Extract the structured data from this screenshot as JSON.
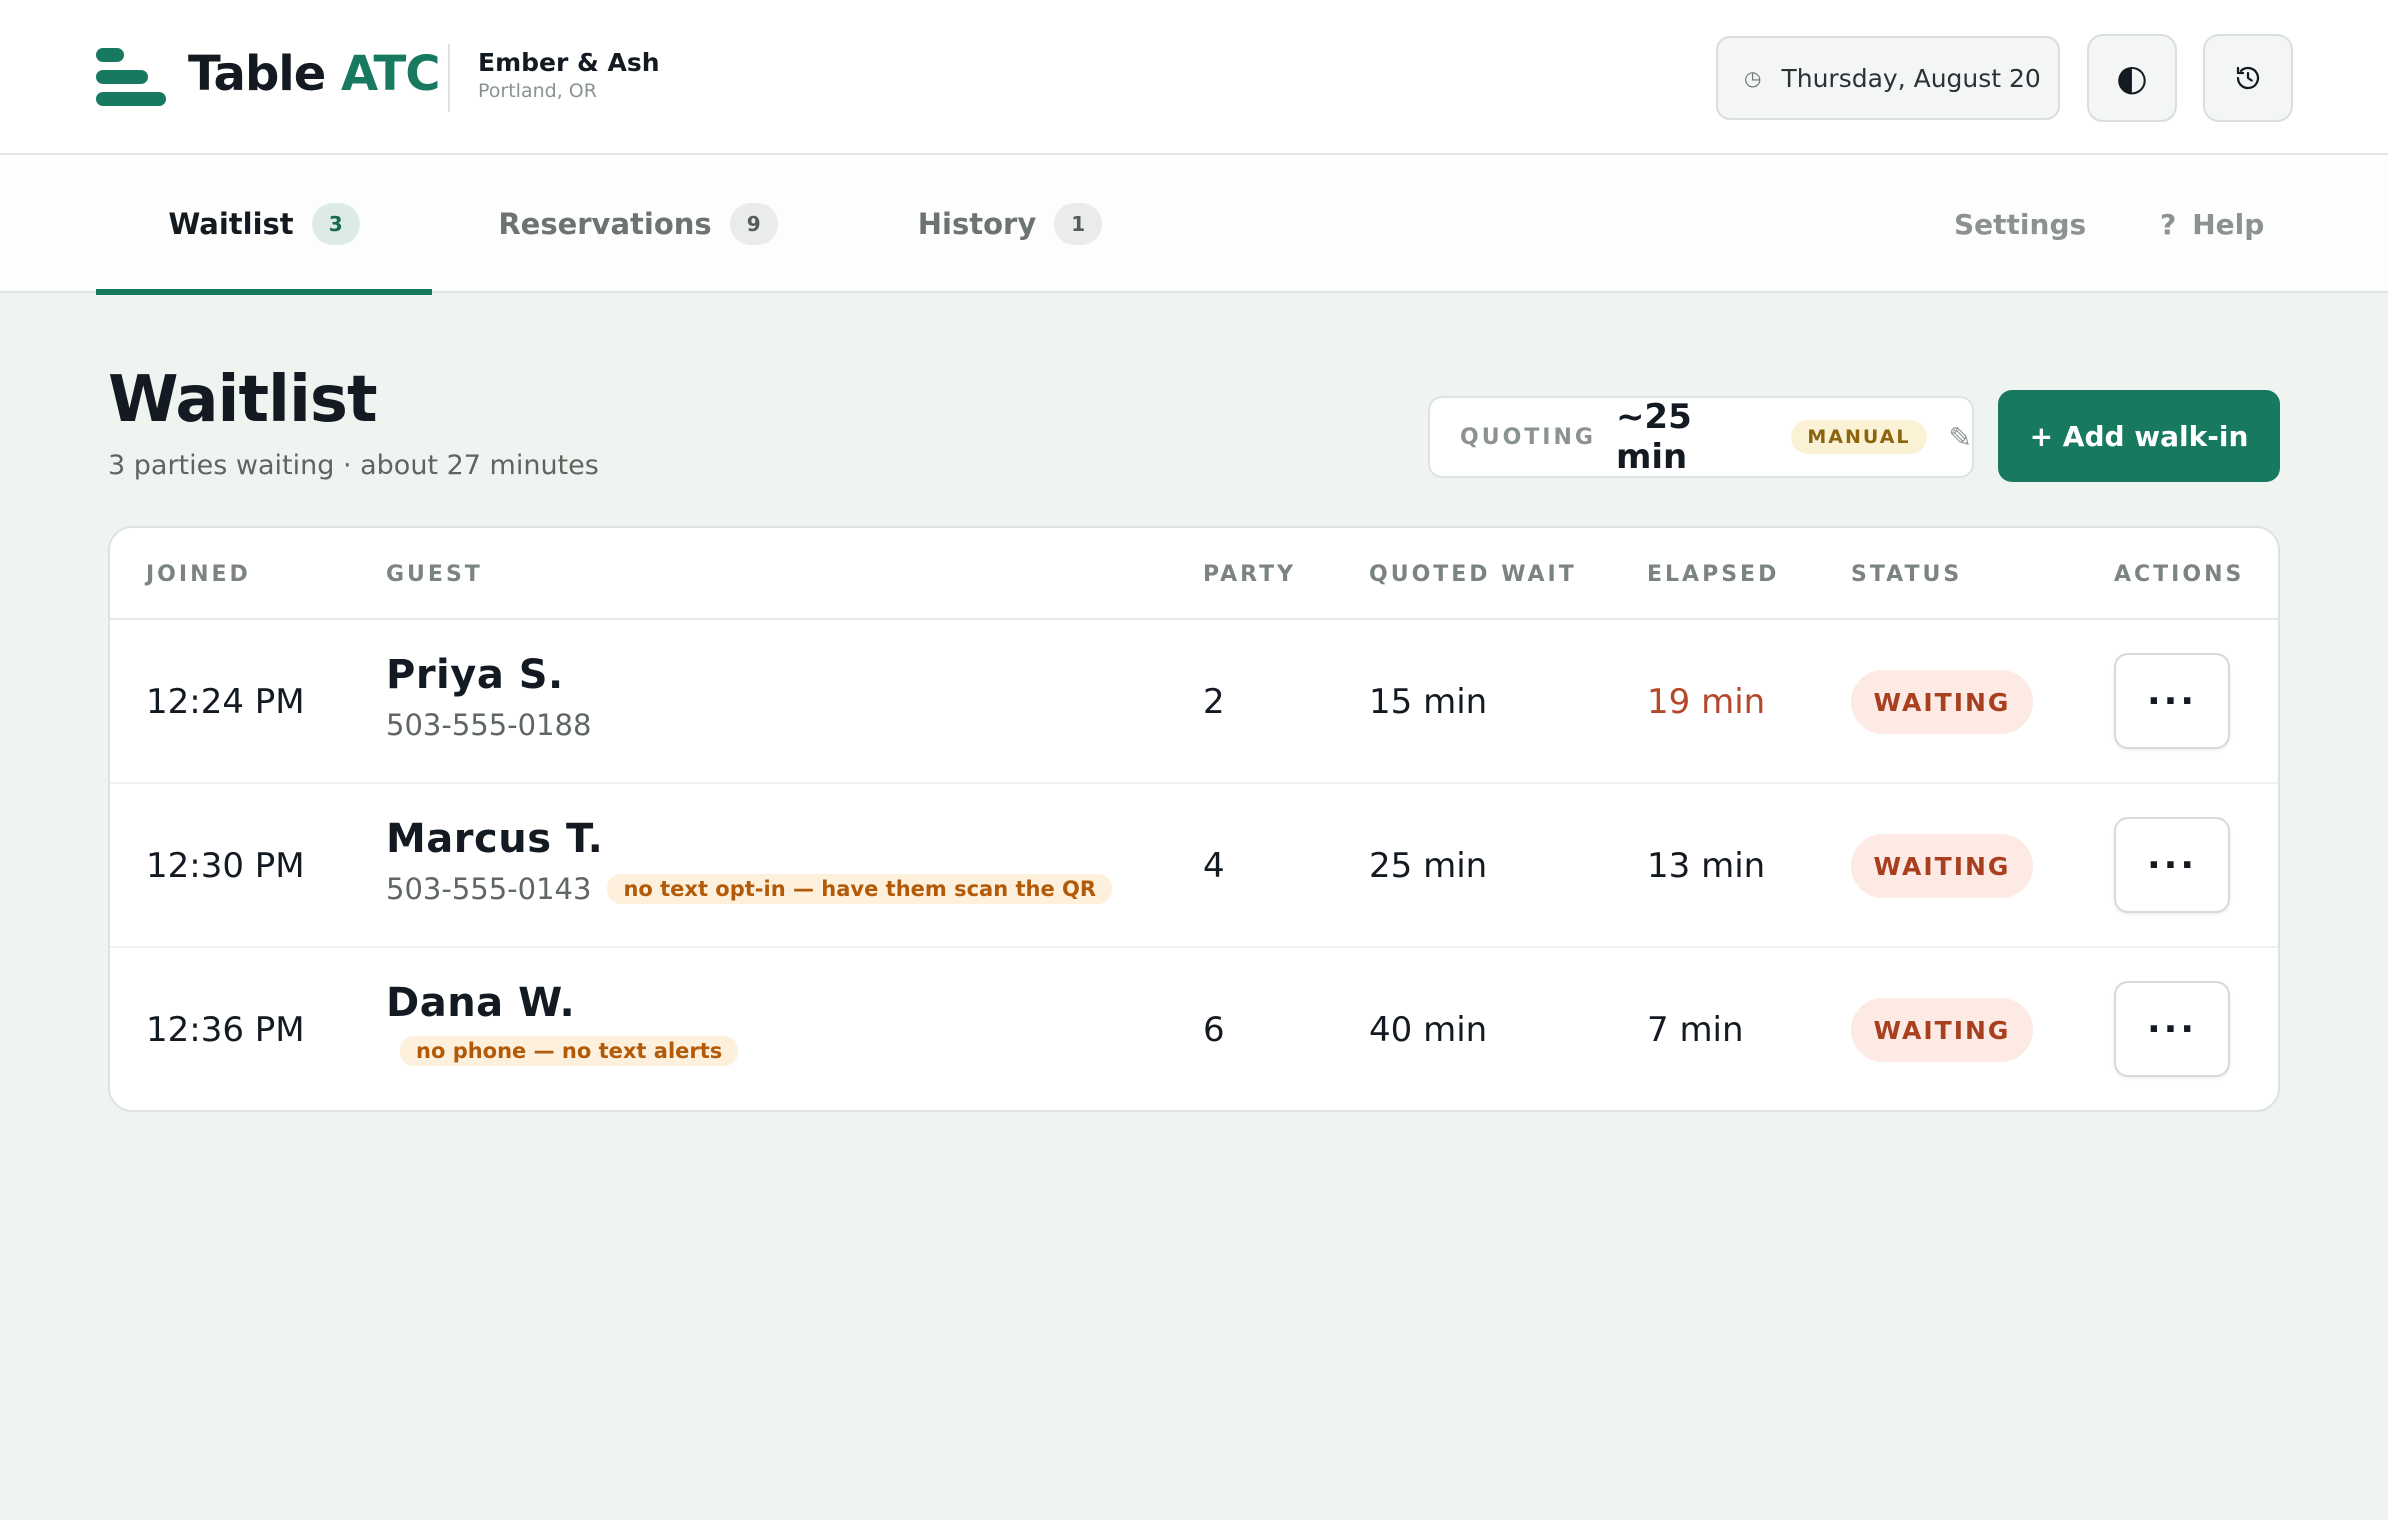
{
  "header": {
    "brand_prefix": "Table ",
    "brand_accent": "ATC",
    "venue_name": "Ember & Ash",
    "venue_location": "Portland, OR",
    "date": "Thursday, August 20",
    "clock_icon": "clock-icon",
    "theme_icon": "half-circle-icon",
    "history_icon": "history-icon"
  },
  "tabs": [
    {
      "label": "Waitlist",
      "count": "3"
    },
    {
      "label": "Reservations",
      "count": "9"
    },
    {
      "label": "History",
      "count": "1"
    }
  ],
  "nav": {
    "settings": "Settings",
    "help_glyph": "?",
    "help": "Help"
  },
  "page": {
    "title": "Waitlist",
    "subtitle": "3 parties waiting · about 27 minutes"
  },
  "quoting": {
    "label": "QUOTING",
    "value": "~25 min",
    "mode": "MANUAL",
    "edit_icon": "pencil-icon"
  },
  "add_button": "+ Add walk-in",
  "table": {
    "columns": [
      "JOINED",
      "GUEST",
      "PARTY",
      "QUOTED WAIT",
      "ELAPSED",
      "STATUS",
      "ACTIONS"
    ],
    "rows": [
      {
        "joined": "12:24 PM",
        "name": "Priya S.",
        "phone": "503-555-0188",
        "note": "",
        "party": "2",
        "quoted": "15 min",
        "elapsed": "19 min",
        "status": "WAITING",
        "actions": "···"
      },
      {
        "joined": "12:30 PM",
        "name": "Marcus T.",
        "phone": "503-555-0143",
        "note": "no text opt-in — have them scan the QR",
        "party": "4",
        "quoted": "25 min",
        "elapsed": "13 min",
        "status": "WAITING",
        "actions": "···"
      },
      {
        "joined": "12:36 PM",
        "name": "Dana W.",
        "phone": "",
        "note": "no phone — no text alerts",
        "party": "6",
        "quoted": "40 min",
        "elapsed": "7 min",
        "status": "WAITING",
        "actions": "···"
      }
    ]
  },
  "colors": {
    "brand": "#177a60",
    "overdue": "#b5482a",
    "status_waiting_bg": "#fdeae4",
    "note_bg": "#fdf0dc"
  }
}
